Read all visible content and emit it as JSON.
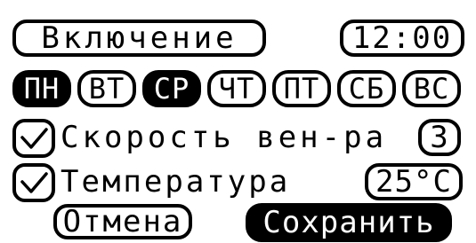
{
  "header": {
    "title": "Включение",
    "time": "12:00"
  },
  "days": [
    {
      "label": "ПН",
      "selected": true
    },
    {
      "label": "ВТ",
      "selected": false
    },
    {
      "label": "СР",
      "selected": true
    },
    {
      "label": "ЧТ",
      "selected": false
    },
    {
      "label": "ПТ",
      "selected": false
    },
    {
      "label": "СБ",
      "selected": false
    },
    {
      "label": "ВС",
      "selected": false
    }
  ],
  "options": {
    "fan_speed": {
      "label": "Скорость вен-ра",
      "value": "3",
      "checked": true
    },
    "temperature": {
      "label": "Температура",
      "value": "25°C",
      "checked": true
    }
  },
  "actions": {
    "cancel_label": "Отмена",
    "save_label": "Сохранить"
  },
  "colors": {
    "foreground": "#000000",
    "background": "#ffffff"
  },
  "icons": {
    "checkbox_mark": "checkmark-icon"
  }
}
